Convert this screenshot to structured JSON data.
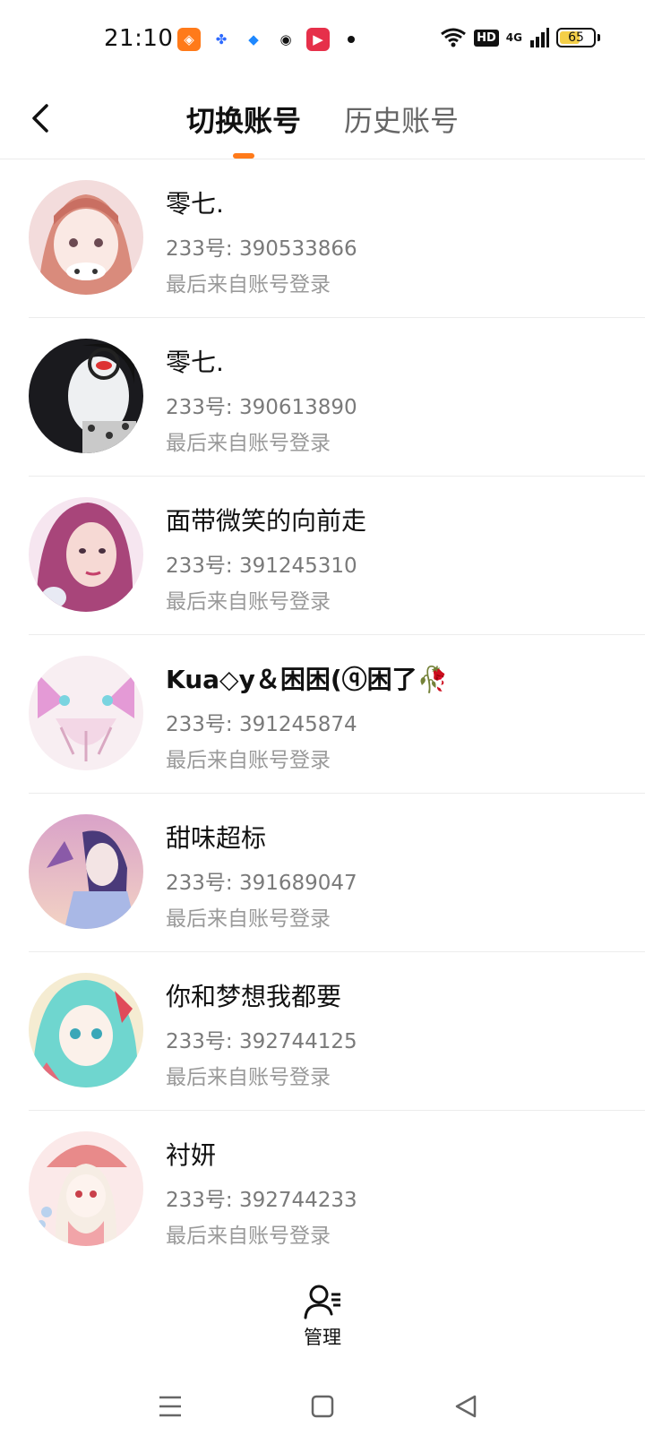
{
  "status_bar": {
    "time": "21:10",
    "network": "4G",
    "hd": "HD",
    "battery": "65",
    "battery_level": 0.65,
    "app_icons": [
      "taobao-icon",
      "baidu-icon",
      "feather-icon",
      "wechat-icon",
      "video-icon"
    ]
  },
  "header": {
    "tabs": [
      "切换账号",
      "历史账号"
    ],
    "active_tab": 0
  },
  "accounts": [
    {
      "name": "零七.",
      "id": "233号: 390533866",
      "last_login": "最后来自账号登录"
    },
    {
      "name": "零七.",
      "id": "233号: 390613890",
      "last_login": "最后来自账号登录"
    },
    {
      "name": "面带微笑的向前走",
      "id": "233号: 391245310",
      "last_login": "最后来自账号登录"
    },
    {
      "name": "Kua◇y＆困困(ⓠ困了🥀",
      "id": "233号: 391245874",
      "last_login": "最后来自账号登录"
    },
    {
      "name": "甜味超标",
      "id": "233号: 391689047",
      "last_login": "最后来自账号登录"
    },
    {
      "name": "你和梦想我都要",
      "id": "233号: 392744125",
      "last_login": "最后来自账号登录"
    },
    {
      "name": "衬妍",
      "id": "233号: 392744233",
      "last_login": "最后来自账号登录"
    }
  ],
  "manage": {
    "label": "管理"
  },
  "colors": {
    "accent": "#ff7a1a",
    "battery": "#f4cf48"
  }
}
